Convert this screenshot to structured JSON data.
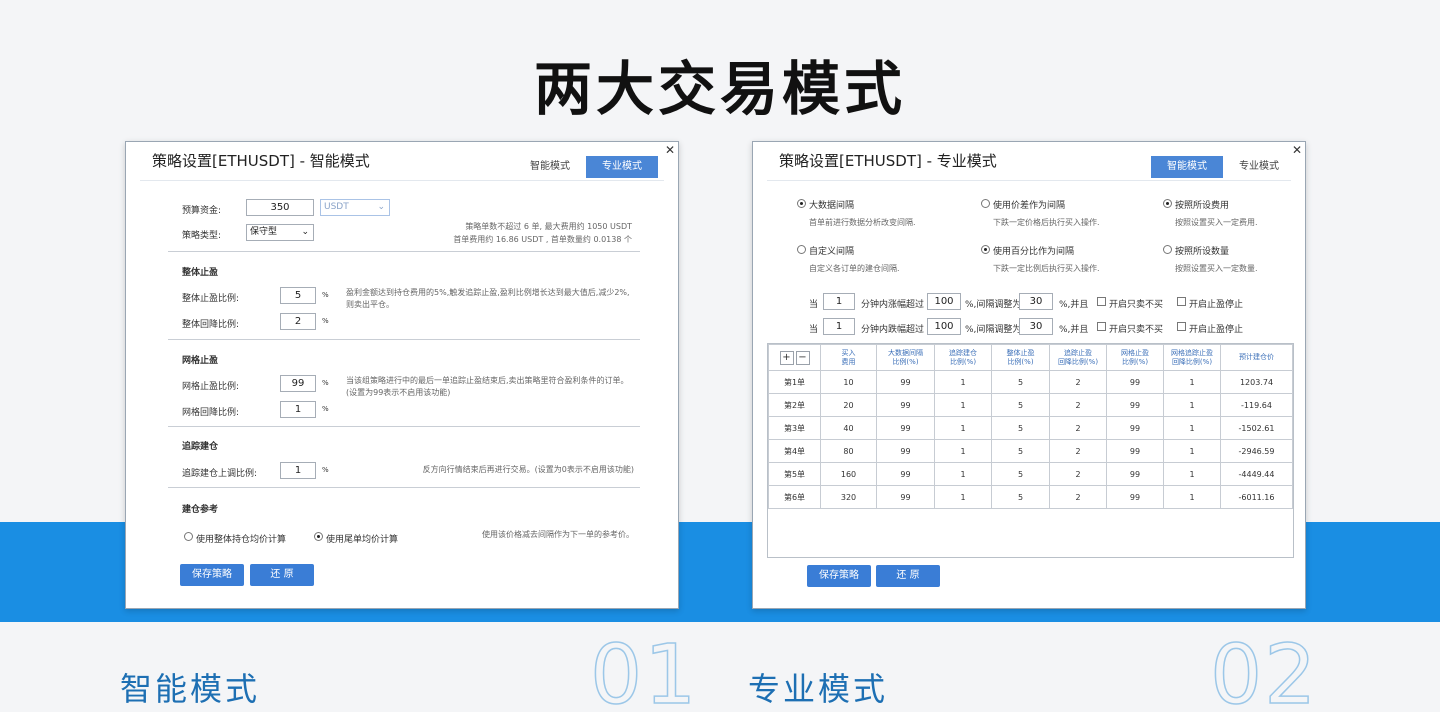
{
  "hero_title": "两大交易模式",
  "left": {
    "title": "策略设置[ETHUSDT] - 智能模式",
    "tabs": [
      "智能模式",
      "专业模式"
    ],
    "budget_label": "预算资金:",
    "budget_value": "350",
    "budget_unit": "USDT",
    "strategy_type_label": "策略类型:",
    "strategy_type_value": "保守型",
    "note_1": "策略单数不超过 6 单, 最大费用约 1050 USDT",
    "note_2": "首单费用约 16.86 USDT , 首单数量约 0.0138 个",
    "sec_total": "整体止盈",
    "total_tp_label": "整体止盈比例:",
    "total_tp_value": "5",
    "total_pb_label": "整体回降比例:",
    "total_pb_value": "2",
    "total_note": "盈利金额达到持仓费用的5%,触发追踪止盈,盈利比例增长达到最大值后,减少2%,则卖出平仓。",
    "sec_grid": "网格止盈",
    "grid_tp_label": "网格止盈比例:",
    "grid_tp_value": "99",
    "grid_pb_label": "网格回降比例:",
    "grid_pb_value": "1",
    "grid_note": "当该组策略进行中的最后一单追踪止盈结束后,卖出策略里符合盈利条件的订单。(设置为99表示不启用该功能)",
    "sec_track": "追踪建仓",
    "track_label": "追踪建仓上调比例:",
    "track_value": "1",
    "track_note": "反方向行情结束后再进行交易。(设置为0表示不启用该功能)",
    "sec_ref": "建仓参考",
    "radio_a": "使用整体持仓均价计算",
    "radio_b": "使用尾单均价计算",
    "ref_note": "使用该价格减去间隔作为下一单的参考价。",
    "percent": "%",
    "save": "保存策略",
    "restore": "还 原"
  },
  "right": {
    "title": "策略设置[ETHUSDT] - 专业模式",
    "tabs": [
      "智能模式",
      "专业模式"
    ],
    "opt1": "大数据间隔",
    "opt1_desc": "首单前进行数据分析改变间隔.",
    "opt2": "使用价差作为间隔",
    "opt2_desc": "下跌一定价格后执行买入操作.",
    "opt3": "按照所设费用",
    "opt3_desc": "按照设置买入一定费用.",
    "opt4": "自定义间隔",
    "opt4_desc": "自定义各订单的建仓间隔.",
    "opt5": "使用百分比作为间隔",
    "opt5_desc": "下跌一定比例后执行买入操作.",
    "opt6": "按照所设数量",
    "opt6_desc": "按照设置买入一定数量.",
    "cond_rows": [
      {
        "prefix": "当",
        "minutes": "1",
        "text1": "分钟内涨幅超过",
        "pct": "100",
        "text2": "%,间隔调整为",
        "gap": "30",
        "text3": "%,并且",
        "chk1": "开启只卖不买",
        "chk2": "开启止盈停止"
      },
      {
        "prefix": "当",
        "minutes": "1",
        "text1": "分钟内跌幅超过",
        "pct": "100",
        "text2": "%,间隔调整为",
        "gap": "30",
        "text3": "%,并且",
        "chk1": "开启只卖不买",
        "chk2": "开启止盈停止"
      }
    ],
    "plus": "+",
    "minus": "−",
    "headers": [
      "买入\n费用",
      "大数据间隔\n比例(%)",
      "追踪建仓\n比例(%)",
      "整体止盈\n比例(%)",
      "追踪止盈\n回降比例(%)",
      "网格止盈\n比例(%)",
      "网格追踪止盈\n回降比例(%)",
      "预计建仓价"
    ],
    "rows": [
      [
        "第1单",
        "10",
        "99",
        "1",
        "5",
        "2",
        "99",
        "1",
        "1203.74"
      ],
      [
        "第2单",
        "20",
        "99",
        "1",
        "5",
        "2",
        "99",
        "1",
        "-119.64"
      ],
      [
        "第3单",
        "40",
        "99",
        "1",
        "5",
        "2",
        "99",
        "1",
        "-1502.61"
      ],
      [
        "第4单",
        "80",
        "99",
        "1",
        "5",
        "2",
        "99",
        "1",
        "-2946.59"
      ],
      [
        "第5单",
        "160",
        "99",
        "1",
        "5",
        "2",
        "99",
        "1",
        "-4449.44"
      ],
      [
        "第6单",
        "320",
        "99",
        "1",
        "5",
        "2",
        "99",
        "1",
        "-6011.16"
      ]
    ],
    "save": "保存策略",
    "restore": "还 原"
  },
  "captions": {
    "left": "智能模式",
    "left_num": "01",
    "right": "专业模式",
    "right_num": "02"
  },
  "colors": {
    "accent": "#1a8ee3",
    "button": "#3a7dd6",
    "tab_active": "#4a86d6"
  }
}
